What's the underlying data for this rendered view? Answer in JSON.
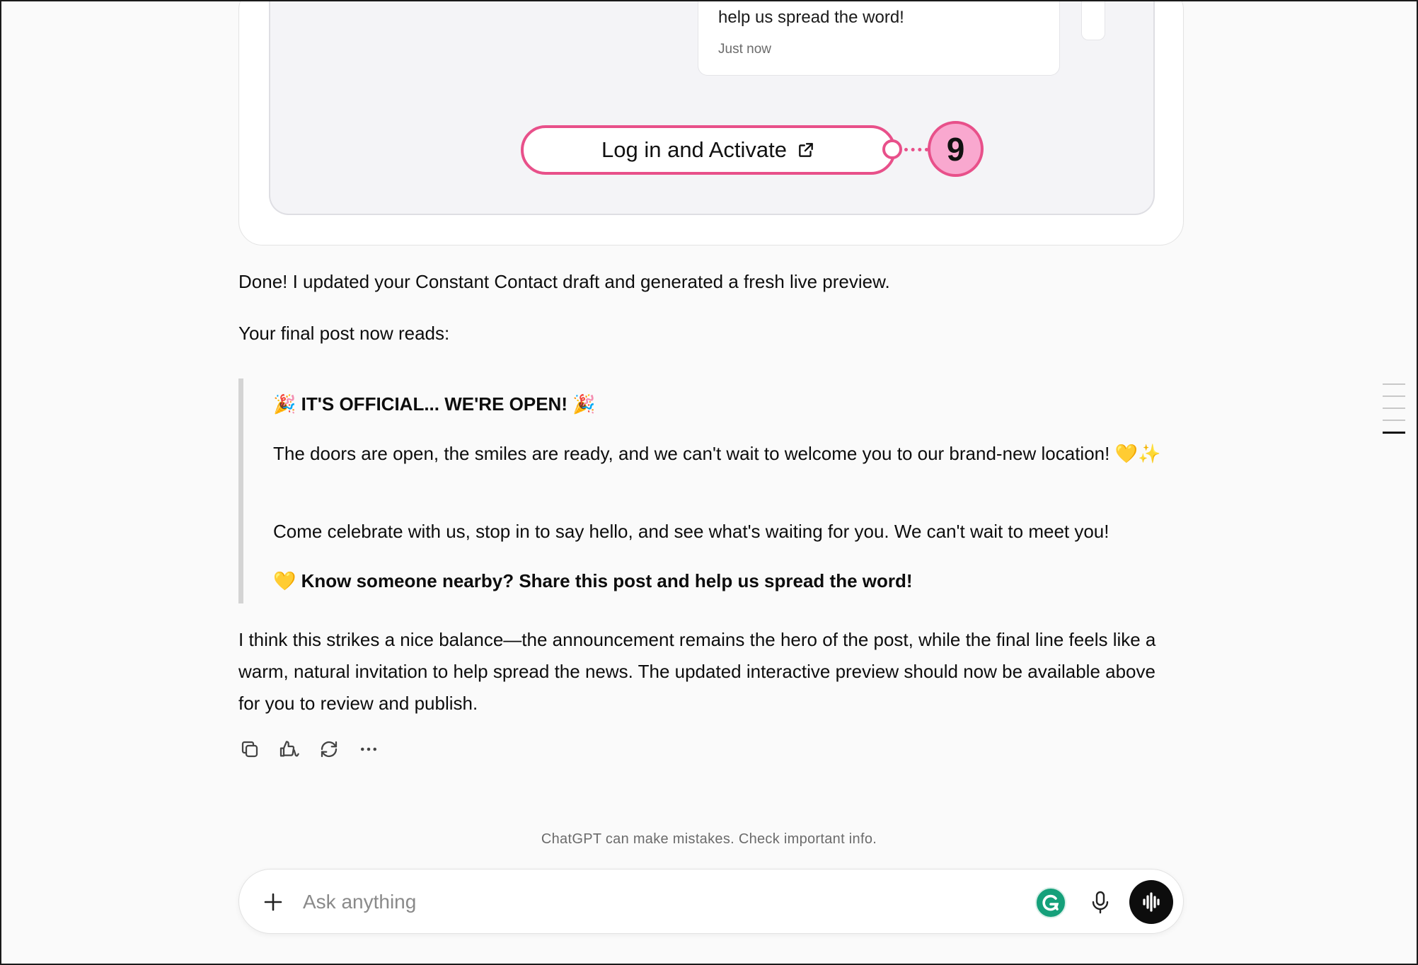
{
  "widget": {
    "post_text": "help us spread the word!",
    "post_time": "Just now",
    "activate_label": "Log in and Activate",
    "annotation_number": "9"
  },
  "message": {
    "intro": "Done! I updated your Constant Contact draft and generated a fresh live preview.",
    "lead": "Your final post now reads:",
    "quote": {
      "headline_emoji_left": "🎉",
      "headline": "IT'S OFFICIAL... WE'RE OPEN!",
      "headline_emoji_right": "🎉",
      "line1": "The doors are open, the smiles are ready, and we can't wait to welcome you to our brand-new location!",
      "line1_emoji": "💛✨",
      "line2": "Come celebrate with us, stop in to say hello, and see what's waiting for you. We can't wait to meet you!",
      "cta_emoji": "💛",
      "cta": "Know someone nearby? Share this post and help us spread the word!"
    },
    "closing": "I think this strikes a nice balance—the announcement remains the hero of the post, while the final line feels like a warm, natural invitation to help spread the news. The updated interactive preview should now be available above for you to review and publish."
  },
  "actions": {
    "copy_icon": "copy-icon",
    "feedback_icon": "thumbs-icon",
    "regenerate_icon": "regenerate-icon",
    "more_icon": "more-icon"
  },
  "footer": {
    "disclaimer": "ChatGPT can make mistakes. Check important info."
  },
  "composer": {
    "placeholder": "Ask anything"
  },
  "colors": {
    "annotation": "#e8508a",
    "annotation_fill": "#f9a8cf",
    "grammarly": "#15a07a"
  }
}
